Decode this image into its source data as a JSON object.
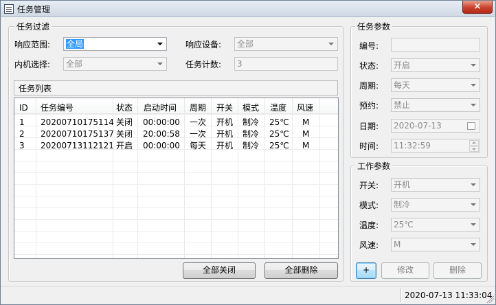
{
  "window": {
    "title": "任务管理",
    "close_label": "×"
  },
  "filter": {
    "group_title": "任务过滤",
    "scope_label": "响应范围:",
    "scope_value": "全局",
    "device_label": "响应设备:",
    "device_value": "全部",
    "unit_label": "内机选择:",
    "unit_value": "全部",
    "count_label": "任务计数:",
    "count_value": "3"
  },
  "task_list": {
    "title": "任务列表",
    "columns": [
      "ID",
      "任务编号",
      "状态",
      "启动时间",
      "周期",
      "开关",
      "模式",
      "温度",
      "风速"
    ],
    "rows": [
      [
        "1",
        "20200710175114",
        "关闭",
        "00:00:00",
        "一次",
        "开机",
        "制冷",
        "25℃",
        "M"
      ],
      [
        "2",
        "20200710175137",
        "关闭",
        "20:00:58",
        "一次",
        "开机",
        "制冷",
        "25℃",
        "M"
      ],
      [
        "3",
        "20200713112121",
        "开启",
        "00:00:00",
        "每天",
        "开机",
        "制冷",
        "25℃",
        "M"
      ]
    ]
  },
  "actions": {
    "close_all": "全部关闭",
    "delete_all": "全部删除"
  },
  "task_params": {
    "group_title": "任务参数",
    "number_label": "编号:",
    "number_value": "",
    "status_label": "状态:",
    "status_value": "开启",
    "cycle_label": "周期:",
    "cycle_value": "每天",
    "booking_label": "预约:",
    "booking_value": "禁止",
    "date_label": "日期:",
    "date_value": "2020-07-13",
    "time_label": "时间:",
    "time_value": "11:32:59"
  },
  "work_params": {
    "group_title": "工作参数",
    "switch_label": "开关:",
    "switch_value": "开机",
    "mode_label": "模式:",
    "mode_value": "制冷",
    "temp_label": "温度:",
    "temp_value": "25℃",
    "speed_label": "风速:",
    "speed_value": "M"
  },
  "param_actions": {
    "add": "+",
    "modify": "修改",
    "delete": "删除"
  },
  "status_bar": {
    "datetime": "2020-07-13 11:33:04"
  },
  "colors": {
    "selection": "#3399ff",
    "close_button": "#c9432e",
    "primary_button_border": "#3c7fb1"
  }
}
